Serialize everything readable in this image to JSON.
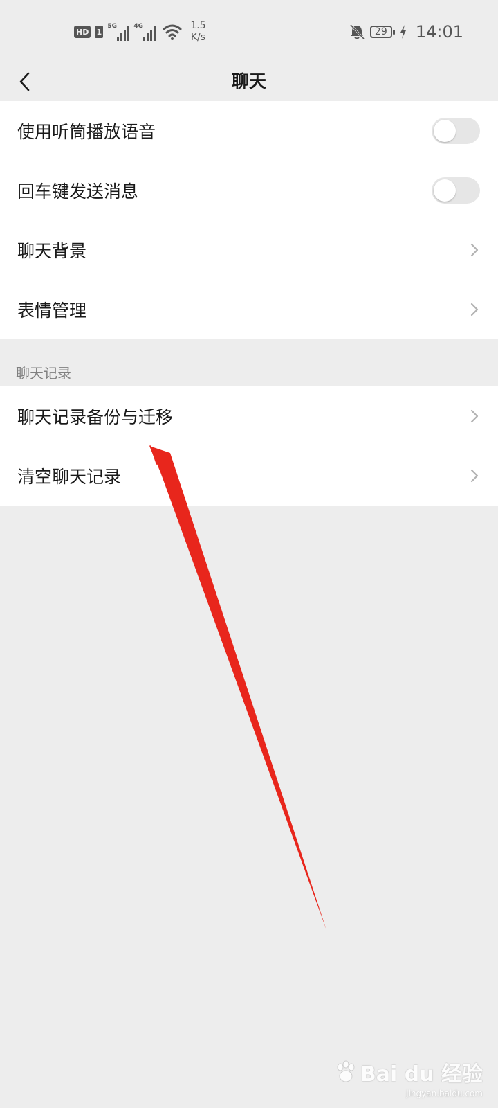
{
  "status_bar": {
    "hd_label": "HD",
    "sim_label": "1",
    "signal1_gen": "5G",
    "signal2_gen": "4G",
    "speed_value": "1.5",
    "speed_unit": "K/s",
    "battery_level": "29",
    "time": "14:01"
  },
  "nav": {
    "title": "聊天",
    "back_icon": "chevron-left-icon"
  },
  "settings": {
    "group1": [
      {
        "label": "使用听筒播放语音",
        "control": "toggle",
        "checked": false
      },
      {
        "label": "回车键发送消息",
        "control": "toggle",
        "checked": false
      },
      {
        "label": "聊天背景",
        "control": "chevron"
      },
      {
        "label": "表情管理",
        "control": "chevron"
      }
    ],
    "section_title": "聊天记录",
    "group2": [
      {
        "label": "聊天记录备份与迁移",
        "control": "chevron"
      },
      {
        "label": "清空聊天记录",
        "control": "chevron"
      }
    ]
  },
  "colors": {
    "background": "#ededed",
    "card": "#ffffff",
    "toggle_off": "#e6e6e6",
    "annotation_arrow": "#e8261c",
    "section_text": "#7f7f7f"
  },
  "watermark": {
    "text": "Bai du 经验",
    "sub": "jingyan.baidu.com"
  }
}
